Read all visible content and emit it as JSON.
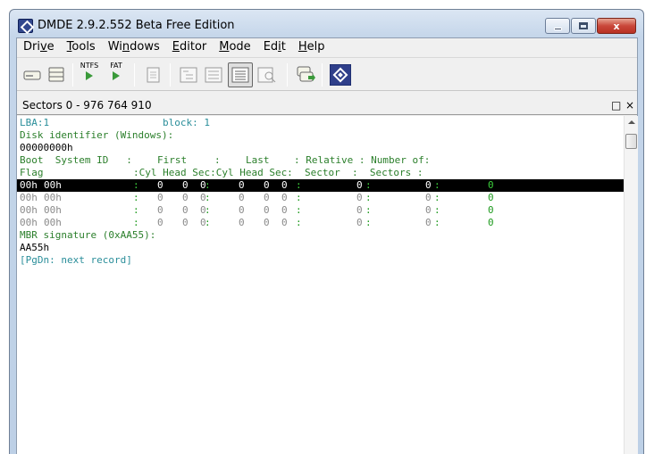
{
  "window": {
    "title": "DMDE 2.9.2.552 Beta Free Edition",
    "close_glyph": "x"
  },
  "menu": [
    {
      "pre": "Dri",
      "acc": "v",
      "post": "e"
    },
    {
      "pre": "",
      "acc": "T",
      "post": "ools"
    },
    {
      "pre": "Wi",
      "acc": "n",
      "post": "dows"
    },
    {
      "pre": "",
      "acc": "E",
      "post": "ditor"
    },
    {
      "pre": "",
      "acc": "M",
      "post": "ode"
    },
    {
      "pre": "Ed",
      "acc": "i",
      "post": "t"
    },
    {
      "pre": "",
      "acc": "H",
      "post": "elp"
    }
  ],
  "toolbar": {
    "ntfs_label": "NTFS",
    "fat_label": "FAT"
  },
  "panel": {
    "title": "Sectors 0 - 976 764 910",
    "restore_glyph": "□",
    "close_glyph": "×"
  },
  "editor": {
    "lba_label": "LBA:1",
    "block_label": "block: 1",
    "disk_id_label": "Disk identifier (Windows):",
    "disk_id_value": "00000000h",
    "header1": {
      "c1": "Boot  System ID   :",
      "c2": "First",
      "c3": ":",
      "c4": "Last",
      "c5": ": Relative : Number of:"
    },
    "header2": {
      "c1": "Flag",
      "c2": ":Cyl Head Sec:Cyl Head Sec:  Sector  :  Sectors :"
    },
    "partitions": [
      {
        "boot": "00h",
        "system": "00h",
        "cyl1": "0",
        "head1": "0",
        "sec1": "0",
        "cyl2": "0",
        "head2": "0",
        "sec2": "0",
        "relative": "0",
        "number": "0",
        "extra": "0"
      },
      {
        "boot": "00h",
        "system": "00h",
        "cyl1": "0",
        "head1": "0",
        "sec1": "0",
        "cyl2": "0",
        "head2": "0",
        "sec2": "0",
        "relative": "0",
        "number": "0",
        "extra": "0"
      },
      {
        "boot": "00h",
        "system": "00h",
        "cyl1": "0",
        "head1": "0",
        "sec1": "0",
        "cyl2": "0",
        "head2": "0",
        "sec2": "0",
        "relative": "0",
        "number": "0",
        "extra": "0"
      },
      {
        "boot": "00h",
        "system": "00h",
        "cyl1": "0",
        "head1": "0",
        "sec1": "0",
        "cyl2": "0",
        "head2": "0",
        "sec2": "0",
        "relative": "0",
        "number": "0",
        "extra": "0"
      }
    ],
    "mbr_label": "MBR signature (0xAA55):",
    "mbr_value": "AA55h",
    "pgdn_hint": "[PgDn: next record]"
  }
}
